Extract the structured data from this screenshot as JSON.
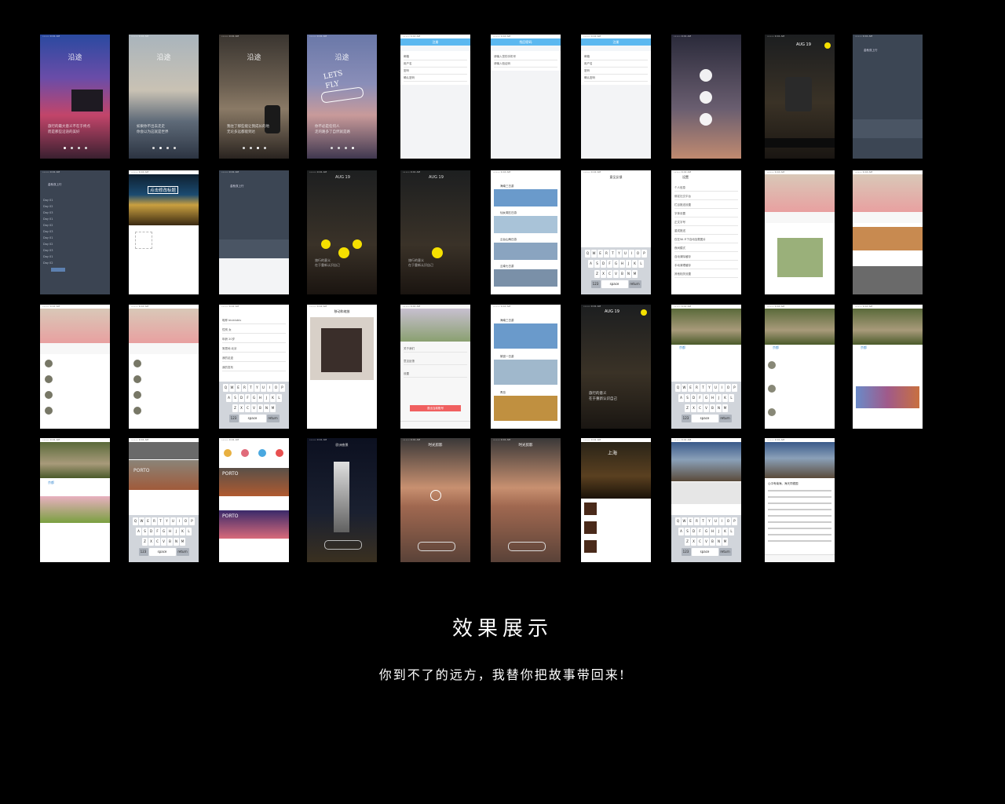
{
  "title": "效果展示",
  "subtitle": "你到不了的远方，我替你把故事带回来!",
  "screens": {
    "splash_title": "沿途",
    "splash_captions": [
      "旅行的最大意义不在于终点\n而是那些沿途的美好",
      "如果你不出去走走\n你会以为这就是世界",
      "我往了那些能让我成长的地\n无论多远都能到达",
      "你不必是任何人\n走的路多了自然就是路"
    ],
    "lets_fly": "LETS FLY",
    "login_nav": "注册",
    "login_fields": [
      "邮箱",
      "用户名",
      "密码",
      "确认密码"
    ],
    "phone_nav": "找回密码",
    "aug_date": "AUG 19",
    "aug_caption": "旅行的意义\n在于重新认识自己",
    "edit_title": "点击修改标题",
    "story_user": "金秋双上行",
    "feedback_nav": "意见反馈",
    "settings_nav": "设置",
    "settings_items": [
      "个人信息",
      "绑定社交平台",
      "栏目推送设置",
      "字体设置",
      "正文字号",
      "重成推送",
      "仅在Wi-Fi下自动加载图片",
      "夜间模式",
      "自动清除缓存",
      "手动清理缓存",
      "其他相关设置"
    ],
    "profile_fields": [
      "昵称",
      "性别",
      "年龄",
      "常居地",
      "我的足迹",
      "我的发布"
    ],
    "profile_values": [
      "biubiubiu",
      "女",
      "20岁",
      "北京"
    ],
    "crop_nav": "移动和缩放",
    "about_items": [
      "关于我们",
      "意见反馈",
      "设置"
    ],
    "logout": "退出当前账号",
    "list_items": [
      "海南三日游",
      "仙女湖五日游",
      "云台山两日游",
      "云南七日游",
      "故宫一日游",
      "青岛"
    ],
    "pathway_name": "京都",
    "cities": [
      "PORTO",
      "上海"
    ],
    "night_title": "欧洲夜景",
    "time_title": "时光剪影",
    "moai_title": "心中有南海。海天同德国",
    "kb_rows": [
      [
        "Q",
        "W",
        "E",
        "R",
        "T",
        "Y",
        "U",
        "I",
        "O",
        "P"
      ],
      [
        "A",
        "S",
        "D",
        "F",
        "G",
        "H",
        "J",
        "K",
        "L"
      ],
      [
        "Z",
        "X",
        "C",
        "V",
        "B",
        "N",
        "M"
      ]
    ],
    "kb_space": "space",
    "kb_return": "return"
  }
}
